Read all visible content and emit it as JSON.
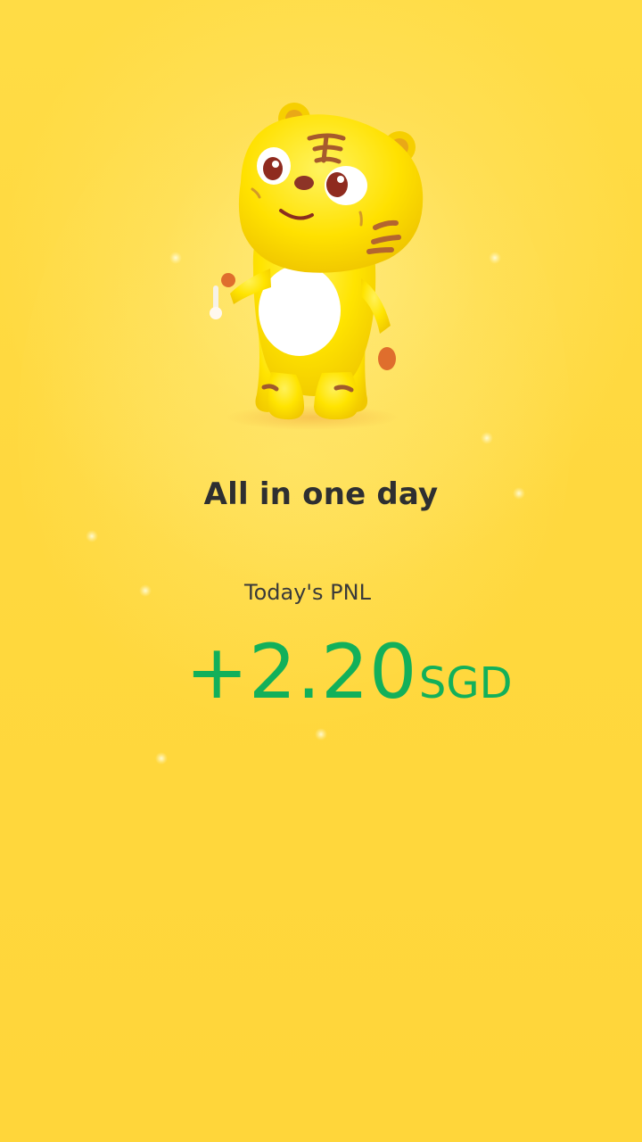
{
  "hero": {
    "mascot": "tiger-mascot",
    "headline": "All in one day"
  },
  "pnl": {
    "label": "Today's PNL",
    "value": "+2.20",
    "currency": "SGD",
    "color": "#12b05a"
  },
  "colors": {
    "background": "#ffd73c",
    "headline": "#2e2f31"
  }
}
